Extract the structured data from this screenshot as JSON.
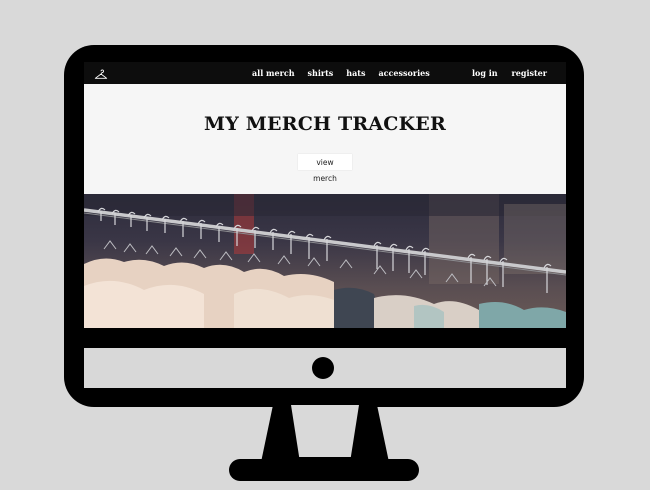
{
  "nav": {
    "links": [
      "all merch",
      "shirts",
      "hats",
      "accessories"
    ],
    "right_links": [
      "log in",
      "register"
    ],
    "logo_icon": "hanger-icon"
  },
  "hero": {
    "title": "MY MERCH TRACKER",
    "button_label": "view merch"
  },
  "photo": {
    "subject": "clothes-rack-image"
  },
  "colors": {
    "navbar": "#0d0d0d",
    "hero_bg": "#f6f6f6",
    "backdrop": "#d9d9d9",
    "monitor": "#000000"
  }
}
